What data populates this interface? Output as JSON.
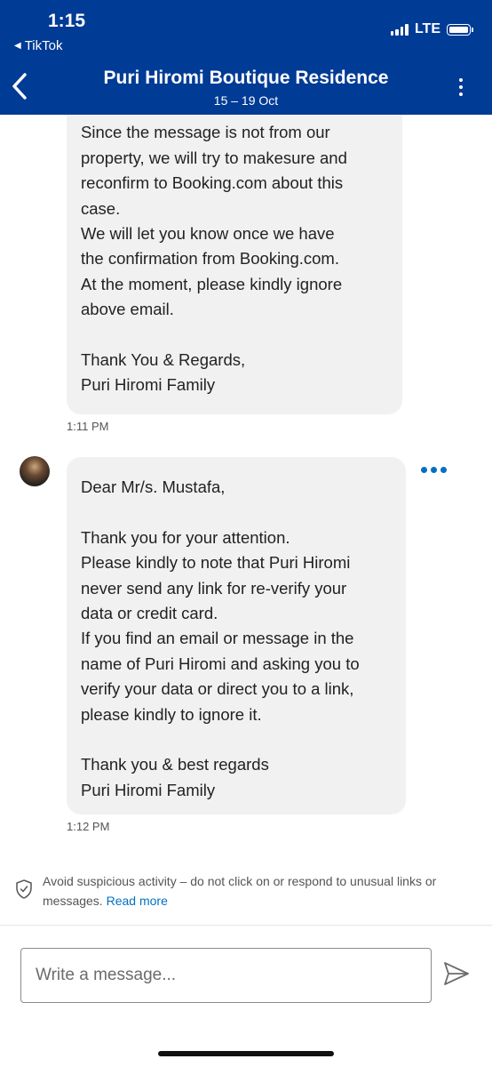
{
  "status_bar": {
    "time": "1:15",
    "back_app": "TikTok",
    "network": "LTE"
  },
  "header": {
    "title": "Puri Hiromi Boutique Residence",
    "dates": "15 – 19 Oct"
  },
  "messages": [
    {
      "text": "inconvenience.\nSince the message is not from our\nproperty, we will try to makesure and\nreconfirm to Booking.com about this\ncase.\nWe will let you know once we have\nthe confirmation from Booking.com.\nAt the moment, please kindly ignore\nabove email.\n\nThank You & Regards,\nPuri Hiromi Family",
      "time": "1:11 PM"
    },
    {
      "text": "Dear Mr/s. Mustafa,\n\nThank you for your attention.\nPlease kindly to note that Puri Hiromi\nnever send any link for re-verify your\ndata or credit card.\nIf you find an email or message in the\nname of Puri Hiromi and asking you to\nverify your data or direct you to a link,\nplease kindly to ignore it.\n\nThank you & best regards\nPuri Hiromi Family",
      "time": "1:12 PM"
    }
  ],
  "notice": {
    "text": "Avoid suspicious activity – do not click on or respond to unusual links or messages.",
    "link": "Read more"
  },
  "composer": {
    "placeholder": "Write a message..."
  },
  "colors": {
    "brand": "#003b95",
    "link": "#0071c2",
    "bubble": "#f1f1f1"
  },
  "icons": [
    "back-chevron-icon",
    "kebab-menu-icon",
    "more-dots-icon",
    "shield-icon",
    "send-icon"
  ]
}
